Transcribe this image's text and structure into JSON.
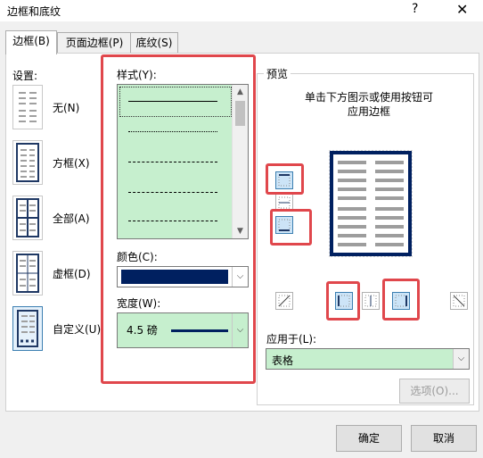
{
  "window": {
    "title": "边框和底纹",
    "help": "?",
    "close": "✕"
  },
  "tabs": [
    {
      "label": "边框(B)"
    },
    {
      "label": "页面边框(P)"
    },
    {
      "label": "底纹(S)"
    }
  ],
  "settings": {
    "heading": "设置:",
    "items": [
      {
        "label": "无(N)"
      },
      {
        "label": "方框(X)"
      },
      {
        "label": "全部(A)"
      },
      {
        "label": "虚框(D)"
      },
      {
        "label": "自定义(U)"
      }
    ]
  },
  "style": {
    "heading": "样式(Y):",
    "items": [
      "solid",
      "dotted-fine",
      "dash-small",
      "dash-medium",
      "dash-dot"
    ]
  },
  "color": {
    "heading": "颜色(C):",
    "value": "#002060"
  },
  "width": {
    "heading": "宽度(W):",
    "value": "4.5 磅"
  },
  "preview": {
    "heading": "预览",
    "hint_line1": "单击下方图示或使用按钮可",
    "hint_line2": "应用边框"
  },
  "apply_to": {
    "heading": "应用于(L):",
    "value": "表格"
  },
  "buttons": {
    "options": "选项(O)...",
    "ok": "确定",
    "cancel": "取消"
  },
  "colors": {
    "highlight": "#c6efce",
    "annotation": "#e0474c",
    "border_color": "#002060"
  }
}
